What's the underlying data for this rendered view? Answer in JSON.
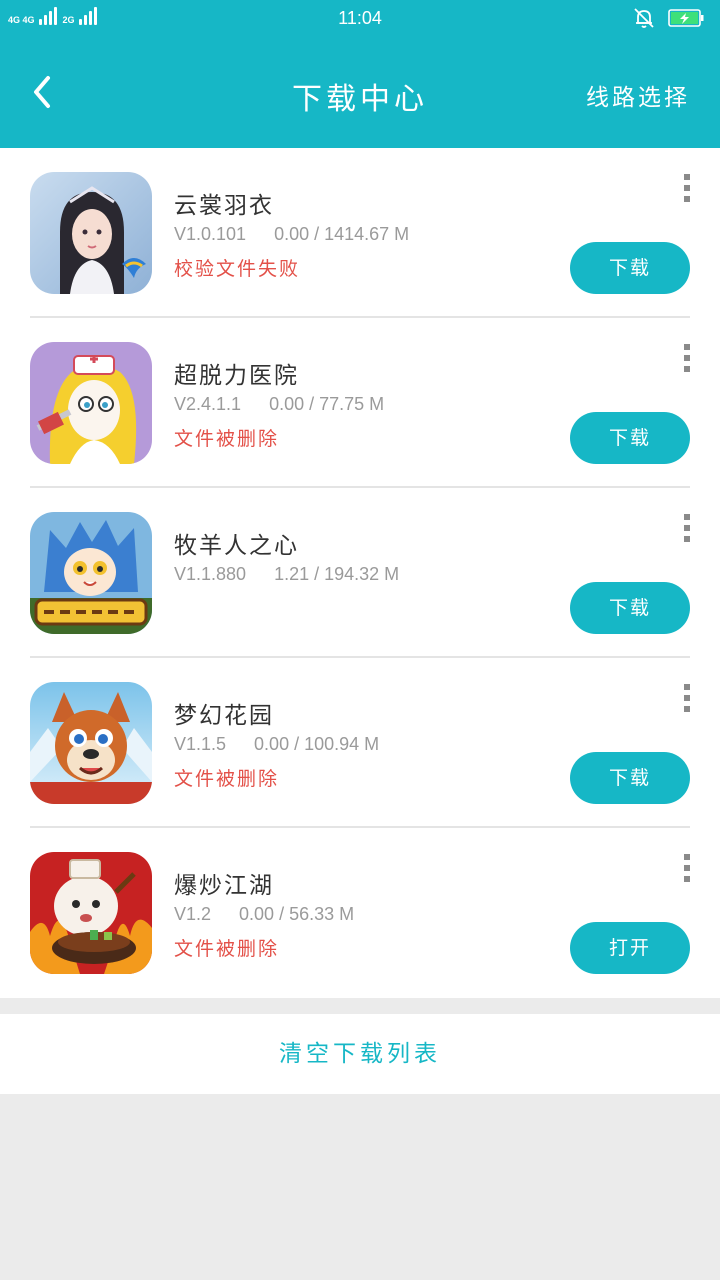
{
  "status_bar": {
    "time": "11:04",
    "signal_left": "4G 4G",
    "signal_right": "2G"
  },
  "header": {
    "back_icon": "chevron-left-icon",
    "title": "下载中心",
    "route_label": "线路选择"
  },
  "downloads": [
    {
      "name": "云裳羽衣",
      "version": "V1.0.101",
      "progress": "0.00 / 1414.67 M",
      "status": "校验文件失败",
      "action": "下载",
      "icon": "yunshang-game-icon"
    },
    {
      "name": "超脱力医院",
      "version": "V2.4.1.1",
      "progress": "0.00 / 77.75 M",
      "status": "文件被删除",
      "action": "下载",
      "icon": "chaotuoli-game-icon"
    },
    {
      "name": "牧羊人之心",
      "version": "V1.1.880",
      "progress": "1.21 / 194.32 M",
      "status": "",
      "action": "下载",
      "icon": "muyang-game-icon"
    },
    {
      "name": "梦幻花园",
      "version": "V1.1.5",
      "progress": "0.00 / 100.94 M",
      "status": "文件被删除",
      "action": "下载",
      "icon": "menghuan-game-icon"
    },
    {
      "name": "爆炒江湖",
      "version": "V1.2",
      "progress": "0.00 / 56.33 M",
      "status": "文件被删除",
      "action": "打开",
      "icon": "baochao-game-icon"
    }
  ],
  "footer": {
    "clear_label": "清空下载列表"
  },
  "colors": {
    "accent": "#16b7c6",
    "error": "#e35149",
    "meta": "#9a9a9a",
    "background": "#ebebeb"
  }
}
